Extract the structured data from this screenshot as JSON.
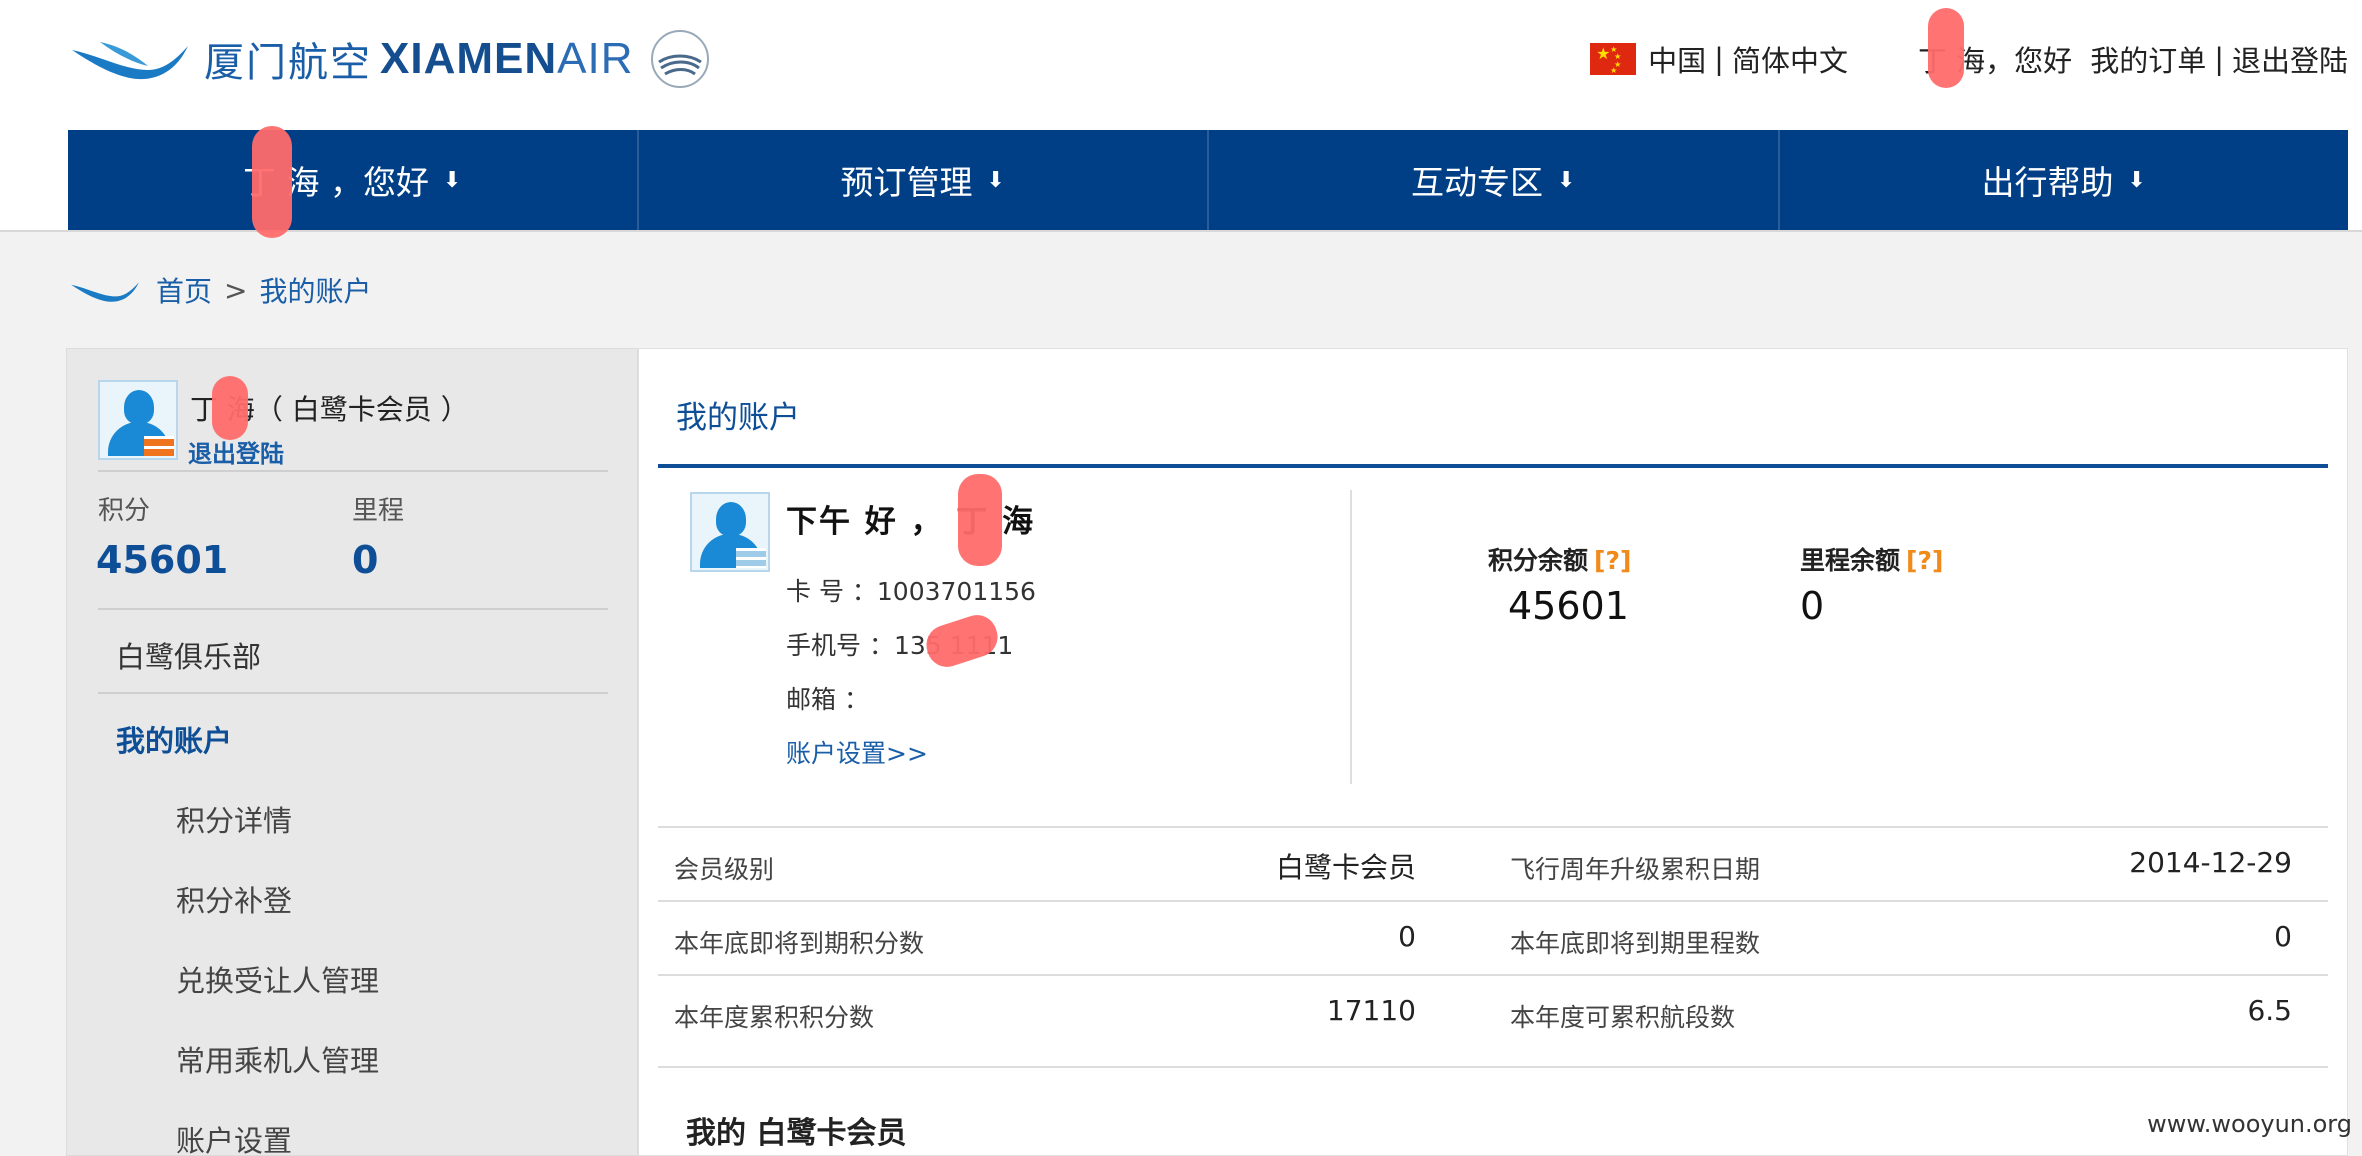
{
  "header": {
    "logo_cn": "厦门航空",
    "logo_en": "XIAMEN",
    "logo_en_air": "AIR",
    "region": "中国",
    "language": "简体中文",
    "greeting_name": "丁 海",
    "greeting_suffix": "，您好",
    "my_orders": "我的订单",
    "logout": "退出登陆",
    "pipe": "|"
  },
  "nav": {
    "items": [
      {
        "label": "丁 海 ，您好"
      },
      {
        "label": "预订管理"
      },
      {
        "label": "互动专区"
      },
      {
        "label": "出行帮助"
      }
    ]
  },
  "breadcrumb": {
    "home": "首页",
    "separator": ">",
    "current": "我的账户"
  },
  "sidebar": {
    "user_line": "丁 海（ 白鹭卡会员 ）",
    "logout": "退出登陆",
    "points_label": "积分",
    "points_value": "45601",
    "miles_label": "里程",
    "miles_value": "0",
    "club": "白鹭俱乐部",
    "my_account": "我的账户",
    "sub_items": [
      "积分详情",
      "积分补登",
      "兑换受让人管理",
      "常用乘机人管理",
      "账户设置"
    ]
  },
  "main": {
    "title": "我的账户",
    "greeting": "下午 好 ， 丁 海",
    "card_no": "卡 号 ：1003701156",
    "phone": "手机号 ：135     1111",
    "email": "邮箱 ：",
    "account_settings_link": "账户设置>>",
    "points_balance_label": "积分余额",
    "points_balance_value": "45601",
    "miles_balance_label": "里程余额",
    "miles_balance_value": "0",
    "help_mark": "[?]",
    "rows": [
      {
        "l_label": "会员级别",
        "l_value": "白鹭卡会员",
        "r_label": "飞行周年升级累积日期",
        "r_value": "2014-12-29"
      },
      {
        "l_label": "本年底即将到期积分数",
        "l_value": "0",
        "r_label": "本年底即将到期里程数",
        "r_value": "0"
      },
      {
        "l_label": "本年度累积积分数",
        "l_value": "17110",
        "r_label": "本年度可累积航段数",
        "r_value": "6.5"
      }
    ],
    "bottom_title": "我的  白鹭卡会员"
  },
  "watermark": "www.wooyun.org",
  "colors": {
    "nav_bg": "#003f85",
    "brand_blue": "#0d4e96",
    "link_blue": "#1a5ea8",
    "help_orange": "#f08a1a",
    "redaction": "#ff6b6b"
  }
}
